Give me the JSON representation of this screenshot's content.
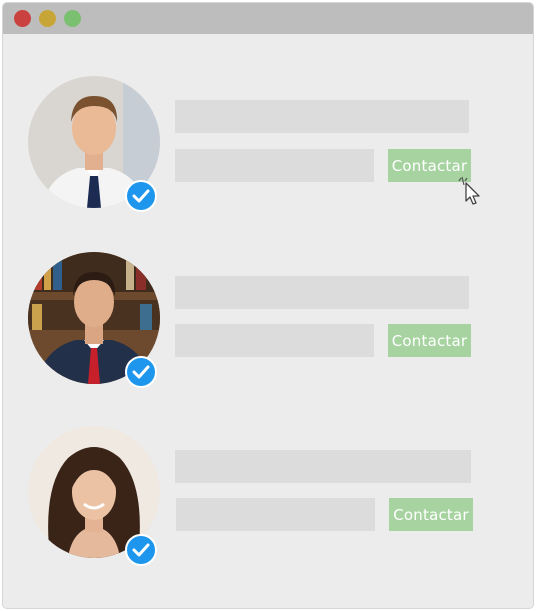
{
  "window": {
    "controls": [
      {
        "name": "close",
        "color": "#c9423f"
      },
      {
        "name": "minimize",
        "color": "#c8a537"
      },
      {
        "name": "maximize",
        "color": "#7bbf70"
      }
    ]
  },
  "contacts": [
    {
      "avatar_icon": "person-photo-icon",
      "verified": true,
      "button_label": "Contactar"
    },
    {
      "avatar_icon": "person-photo-icon",
      "verified": true,
      "button_label": "Contactar"
    },
    {
      "avatar_icon": "person-photo-icon",
      "verified": true,
      "button_label": "Contactar"
    }
  ],
  "colors": {
    "accent_button": "#a6d3a0",
    "verified_badge": "#1e96ee",
    "placeholder_bar": "#dcdcdc",
    "background": "#ececec"
  },
  "cursor": {
    "icon": "pointer-cursor-icon"
  }
}
